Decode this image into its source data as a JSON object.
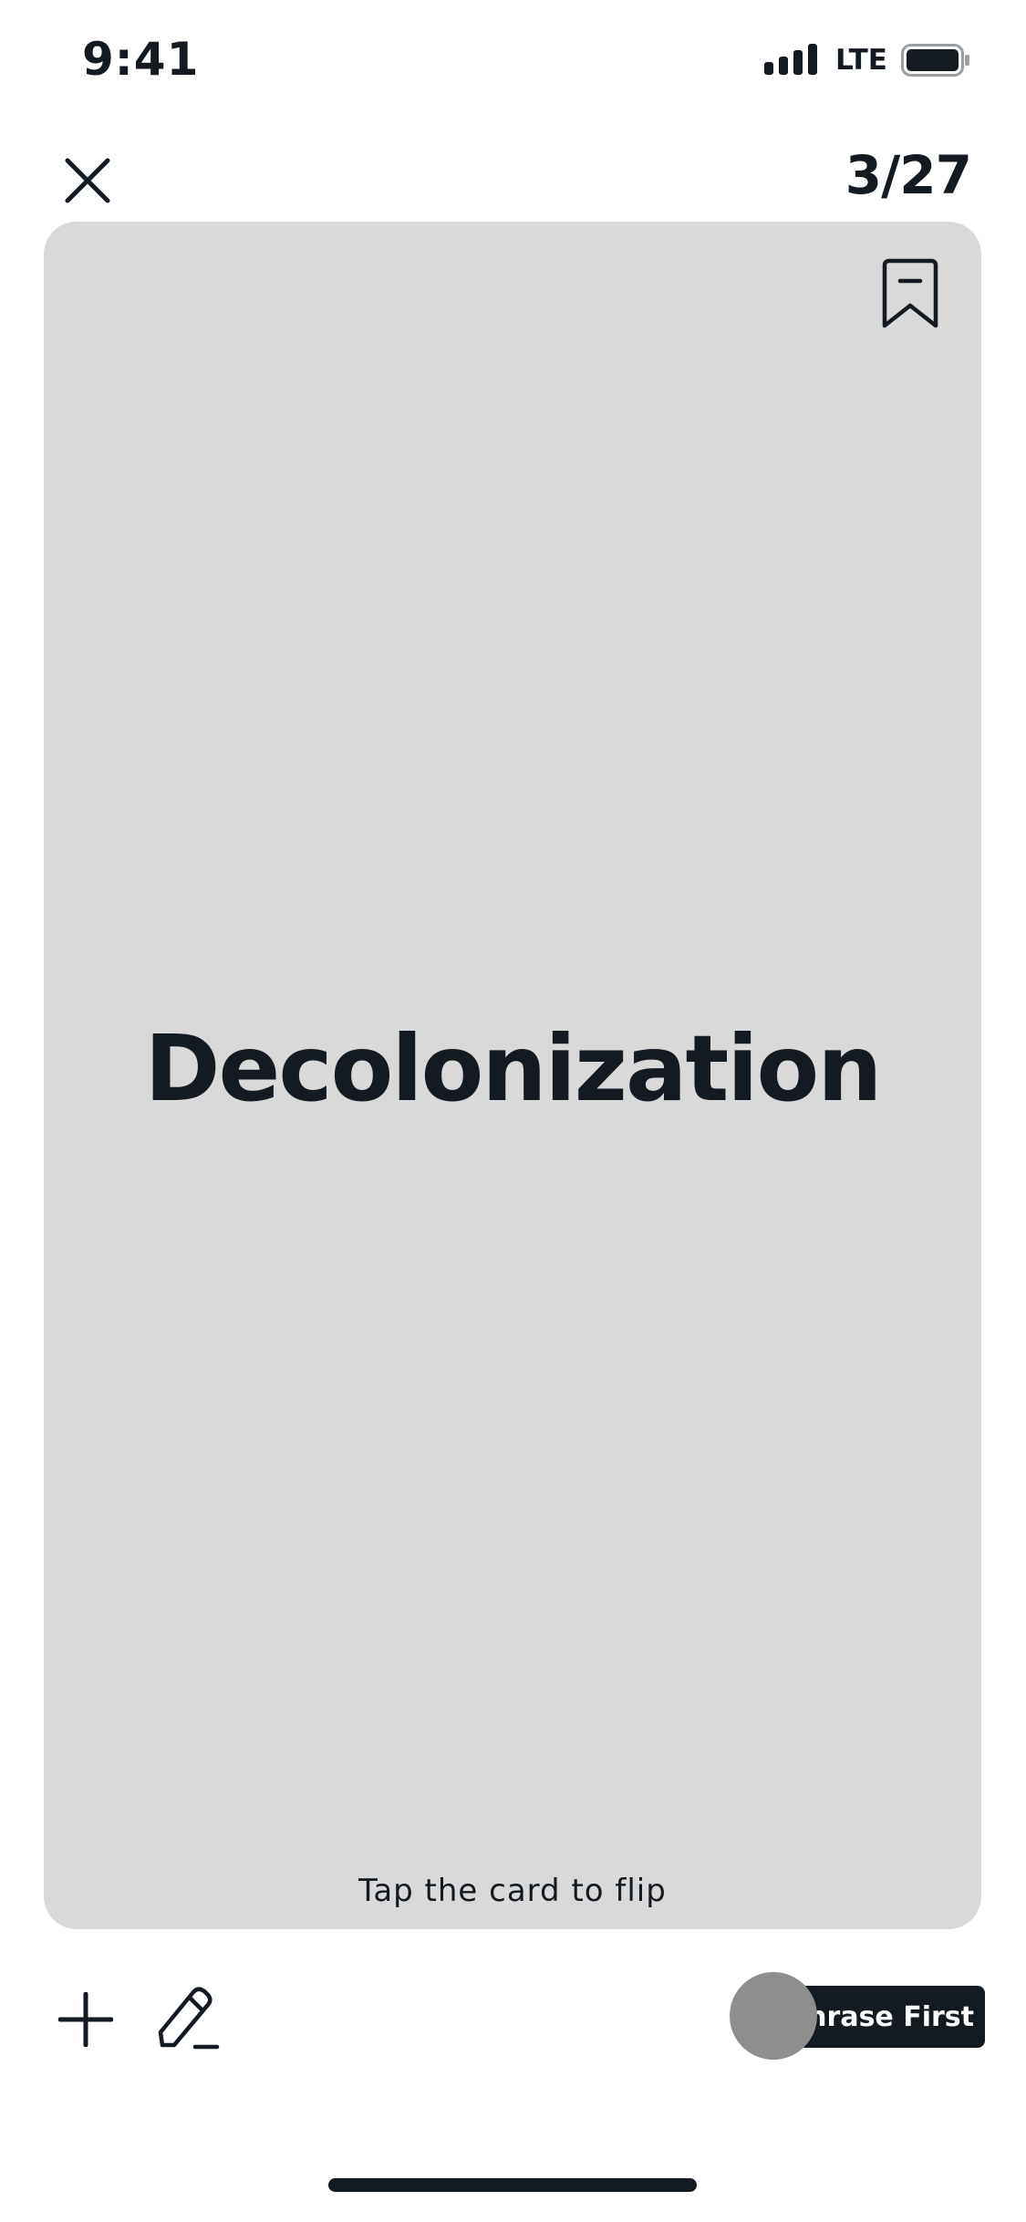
{
  "status_bar": {
    "time": "9:41",
    "network": "LTE",
    "icons": [
      "signal-icon",
      "battery-icon"
    ]
  },
  "header": {
    "close_icon": "close-icon",
    "progress": "3/27"
  },
  "card": {
    "term": "Decolonization",
    "hint": "Tap the card to flip",
    "bookmark_icon": "bookmark-icon",
    "background": "#d9d9d9"
  },
  "toolbar": {
    "add_icon": "plus-icon",
    "edit_icon": "pencil-icon",
    "mode_label": "Phrase First"
  },
  "colors": {
    "text": "#131a22",
    "card": "#d9d9d9",
    "toggle_knob": "#8e8e8e",
    "toggle_track": "#131a22"
  }
}
